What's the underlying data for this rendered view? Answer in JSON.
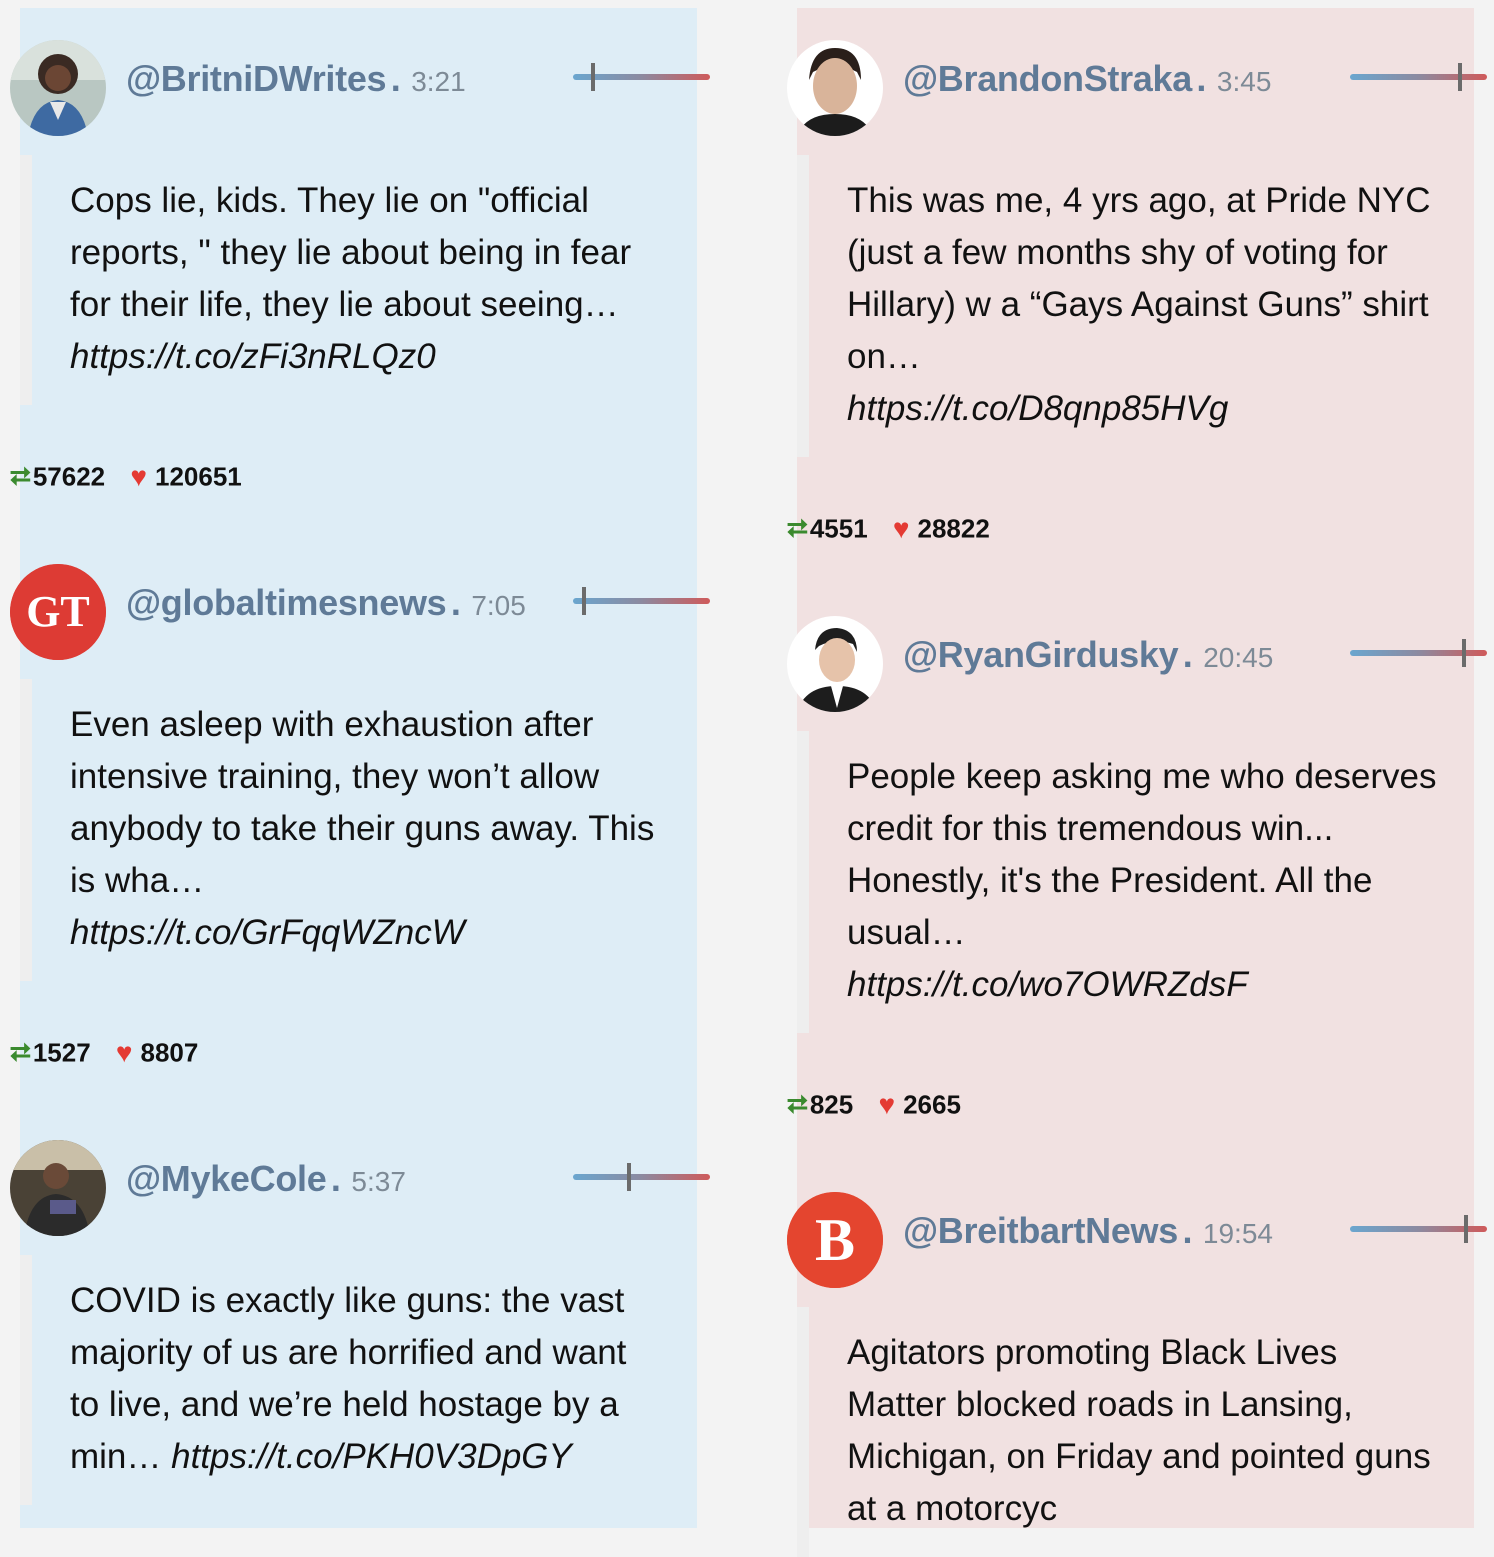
{
  "left_column": [
    {
      "handle": "@BritniDWrites",
      "dot": ".",
      "time": "3:21",
      "avatar_icon": "person-photo-icon",
      "text": "Cops lie, kids. They lie on \"official reports, \" they lie about being in fear for their life, they lie about seeing…",
      "link": "https://t.co/zFi3nRLQz0",
      "retweets": "57622",
      "likes": "120651",
      "lean_fraction": 0.15
    },
    {
      "handle": "@globaltimesnews",
      "dot": ".",
      "time": "7:05",
      "avatar_icon": "gt-logo-icon",
      "avatar_text": "GT",
      "text": "Even asleep with exhaustion after intensive training, they won’t allow anybody to take their guns away. This is wha…",
      "link": "https://t.co/GrFqqWZncW",
      "retweets": "1527",
      "likes": "8807",
      "lean_fraction": 0.08
    },
    {
      "handle": "@MykeCole",
      "dot": ".",
      "time": "5:37",
      "avatar_icon": "person-photo-icon",
      "text": "COVID is exactly like guns: the vast majority of us are horrified and want to live, and we’re held hostage by a min…",
      "link": "https://t.co/PKH0V3DpGY",
      "retweets": "",
      "likes": "",
      "lean_fraction": 0.41
    }
  ],
  "right_column": [
    {
      "handle": "@BrandonStraka",
      "dot": ".",
      "time": "3:45",
      "avatar_icon": "person-photo-icon",
      "text": "This was me, 4 yrs ago, at Pride NYC (just a few months shy of voting for Hillary) w a “Gays Against Guns” shirt on…",
      "link": "https://t.co/D8qnp85HVg",
      "retweets": "4551",
      "likes": "28822",
      "lean_fraction": 0.8
    },
    {
      "handle": "@RyanGirdusky",
      "dot": ".",
      "time": "20:45",
      "avatar_icon": "person-photo-icon",
      "text": "People keep asking me who deserves credit for this tremendous win... Honestly, it's the President. All the usual…",
      "link": "https://t.co/wo7OWRZdsF",
      "retweets": "825",
      "likes": "2665",
      "lean_fraction": 0.83
    },
    {
      "handle": "@BreitbartNews",
      "dot": ".",
      "time": "19:54",
      "avatar_icon": "breitbart-logo-icon",
      "avatar_text": "B",
      "text": "Agitators promoting Black Lives Matter blocked roads in Lansing, Michigan, on Friday and pointed guns at a motorcyc",
      "link": "",
      "retweets": "",
      "likes": "",
      "lean_fraction": 0.85
    }
  ],
  "icons": {
    "retweet": "retweet-icon",
    "like": "heart-icon"
  },
  "colors": {
    "left_bg": "#deedf6",
    "right_bg": "#f1e1e1",
    "handle": "#5f7a97",
    "heart": "#e43a33",
    "retweet": "#3b8a2e"
  }
}
